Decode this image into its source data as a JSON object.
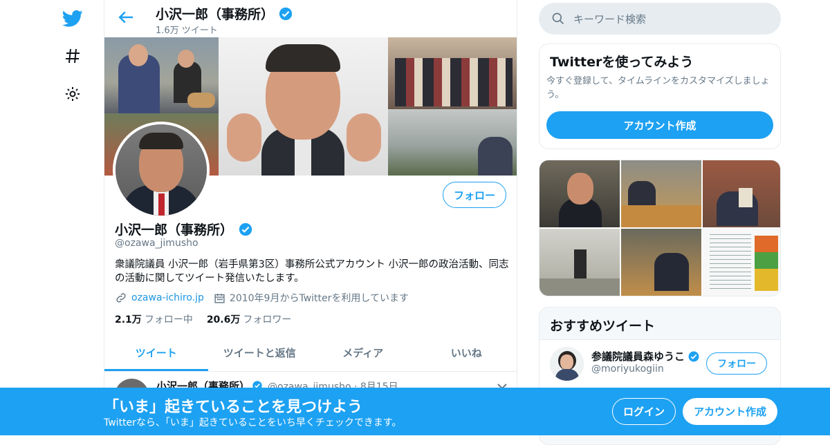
{
  "nav": {
    "icons": [
      "twitter-bird-icon",
      "hashtag-icon",
      "gear-icon"
    ]
  },
  "header": {
    "name": "小沢一郎（事務所）",
    "tweet_count": "1.6万 ツイート"
  },
  "profile": {
    "follow_label": "フォロー",
    "name": "小沢一郎（事務所）",
    "handle": "@ozawa_jimusho",
    "bio": "衆議院議員 小沢一郎（岩手県第3区）事務所公式アカウント 小沢一郎の政治活動、同志の活動に関してツイート発信いたします。",
    "website": "ozawa-ichiro.jp",
    "joined": "2010年9月からTwitterを利用しています",
    "following_count": "2.1万",
    "following_label": "フォロー中",
    "followers_count": "20.6万",
    "followers_label": "フォロワー"
  },
  "tabs": [
    {
      "label": "ツイート",
      "active": true
    },
    {
      "label": "ツイートと返信",
      "active": false
    },
    {
      "label": "メディア",
      "active": false
    },
    {
      "label": "いいね",
      "active": false
    }
  ],
  "tweet_peek": {
    "name": "小沢一郎（事務所）",
    "handle_date": "@ozawa_jimusho · 8月15日"
  },
  "search": {
    "placeholder": "キーワード検索"
  },
  "try_card": {
    "title": "Twitterを使ってみよう",
    "description": "今すぐ登録して、タイムラインをカスタマイズしましょう。",
    "button": "アカウント作成"
  },
  "recommend": {
    "title": "おすすめツイート",
    "user_name": "参議院議員森ゆうこ",
    "user_handle": "@moriyukogiin",
    "follow_label": "フォロー"
  },
  "bottom_bar": {
    "title": "「いま」起きていることを見つけよう",
    "subtitle": "Twitterなら、「いま」起きていることをいち早くチェックできます。",
    "login": "ログイン",
    "signup": "アカウント作成"
  },
  "colors": {
    "accent": "#1da1f2",
    "muted": "#657786",
    "border": "#e6ecf0"
  }
}
